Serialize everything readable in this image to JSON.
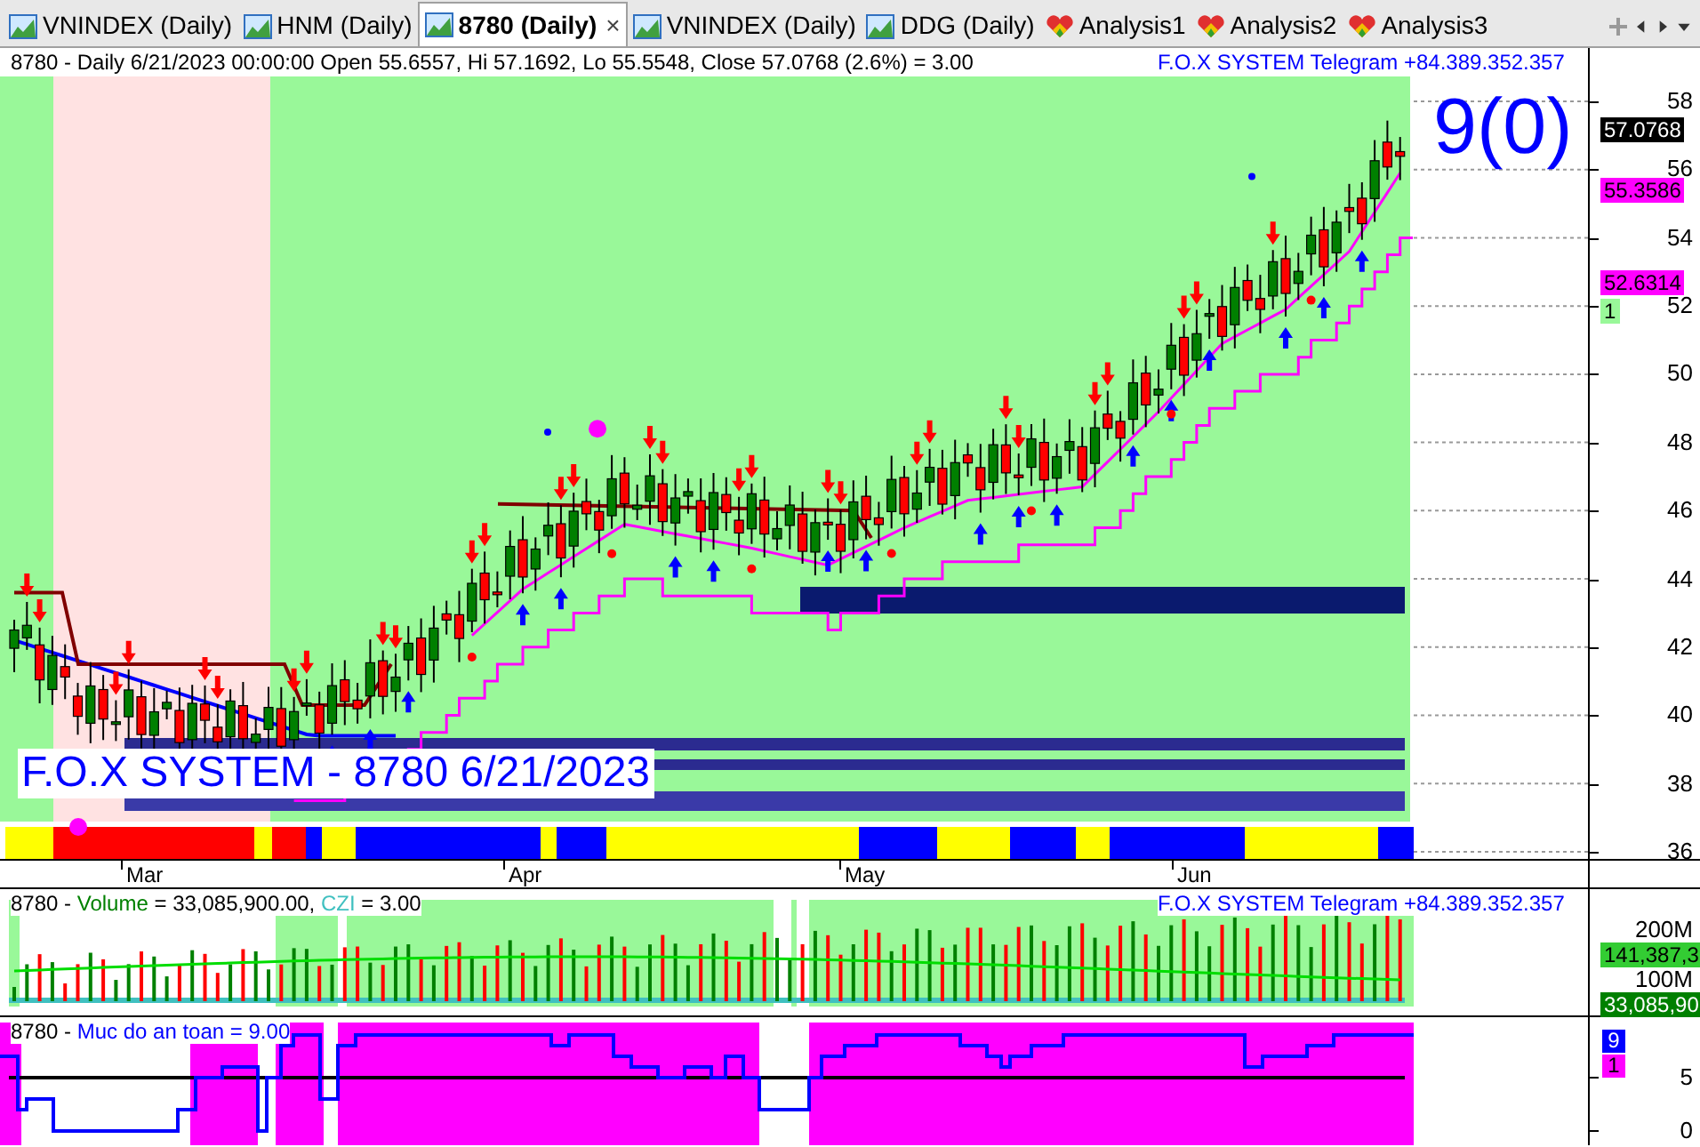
{
  "tabs": [
    {
      "label": "VNINDEX (Daily)",
      "kind": "chart",
      "selected": false
    },
    {
      "label": "HNM (Daily)",
      "kind": "chart",
      "selected": false
    },
    {
      "label": "8780 (Daily)",
      "kind": "chart",
      "selected": true,
      "close": "×"
    },
    {
      "label": "VNINDEX (Daily)",
      "kind": "chart",
      "selected": false
    },
    {
      "label": "DDG (Daily)",
      "kind": "chart",
      "selected": false
    },
    {
      "label": "Analysis1",
      "kind": "analysis",
      "selected": false
    },
    {
      "label": "Analysis2",
      "kind": "analysis",
      "selected": false
    },
    {
      "label": "Analysis3",
      "kind": "analysis",
      "selected": false
    }
  ],
  "price_panel": {
    "header": "8780 - Daily 6/21/2023 00:00:00 Open 55.6557, Hi 57.1692, Lo 55.5548, Close 57.0768 (2.6%)  = 3.00",
    "telegram": "F.O.X SYSTEM Telegram +84.389.352.357",
    "signal": "9(0)",
    "caption": "F.O.X SYSTEM - 8780 6/21/2023",
    "y_ticks": [
      "58",
      "56",
      "54",
      "52",
      "50",
      "48",
      "46",
      "44",
      "42",
      "40",
      "38",
      "36"
    ],
    "tags": [
      {
        "text": "57.0768",
        "color": "#000000"
      },
      {
        "text": "55.3586",
        "color": "#ff00ff"
      },
      {
        "text": "52.6314",
        "color": "#ff00ff"
      },
      {
        "text": "1",
        "color": "#99f899"
      }
    ]
  },
  "date_labels": [
    "Mar",
    "Apr",
    "May",
    "Jun"
  ],
  "volume_panel": {
    "header": [
      "8780 - ",
      "Volume",
      " = 33,085,900.00, ",
      "CZI",
      " = 3.00"
    ],
    "telegram": "F.O.X SYSTEM Telegram +84.389.352.357",
    "y_ticks": [
      "200M",
      "100M"
    ],
    "tags": [
      {
        "text": "141,387,3",
        "color": "#33cc33"
      },
      {
        "text": "33,085,90",
        "color": "#008000"
      }
    ]
  },
  "safety_panel": {
    "header": [
      "8780 - ",
      "Muc do an toan = 9.00"
    ],
    "y_ticks": [
      "5",
      "0"
    ],
    "tags": [
      {
        "text": "9",
        "color": "#0000ff"
      },
      {
        "text": "1",
        "color": "#ff00ff"
      }
    ]
  }
}
